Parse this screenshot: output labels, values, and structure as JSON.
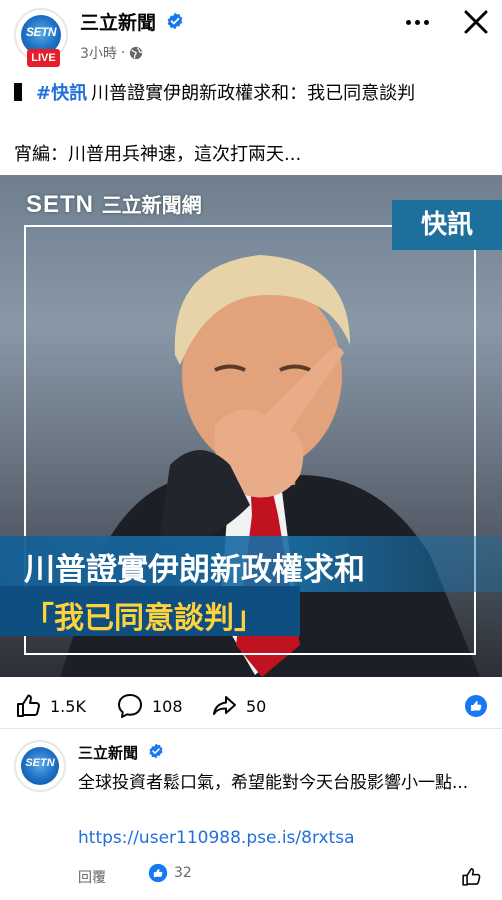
{
  "header": {
    "page_name": "三立新聞",
    "time": "3小時",
    "separator": "·",
    "avatar_logo": "SETN",
    "live_badge": "LIVE"
  },
  "post": {
    "tag": "#快訊",
    "headline": "川普證實伊朗新政權求和：我已同意談判",
    "subline": "宵編：川普用兵神速，這次打兩天..."
  },
  "image": {
    "watermark_latin": "SETN",
    "watermark_cn": "三立新聞網",
    "flash_badge": "快訊",
    "banner_line1": "川普證實伊朗新政權求和",
    "banner_line2": "「我已同意談判」"
  },
  "actions": {
    "likes": "1.5K",
    "comments": "108",
    "shares": "50"
  },
  "comment": {
    "author": "三立新聞",
    "avatar_logo": "SETN",
    "body": "全球投資者鬆口氣，希望能對今天台股影響小一點...",
    "link": "https://user110988.pse.is/8rxtsa",
    "reply_label": "回覆",
    "reaction_count": "32"
  },
  "colors": {
    "accent": "#216fdb",
    "live": "#e41e2b",
    "banner": "#1d6f9c",
    "banner_highlight": "#ffd23a"
  }
}
